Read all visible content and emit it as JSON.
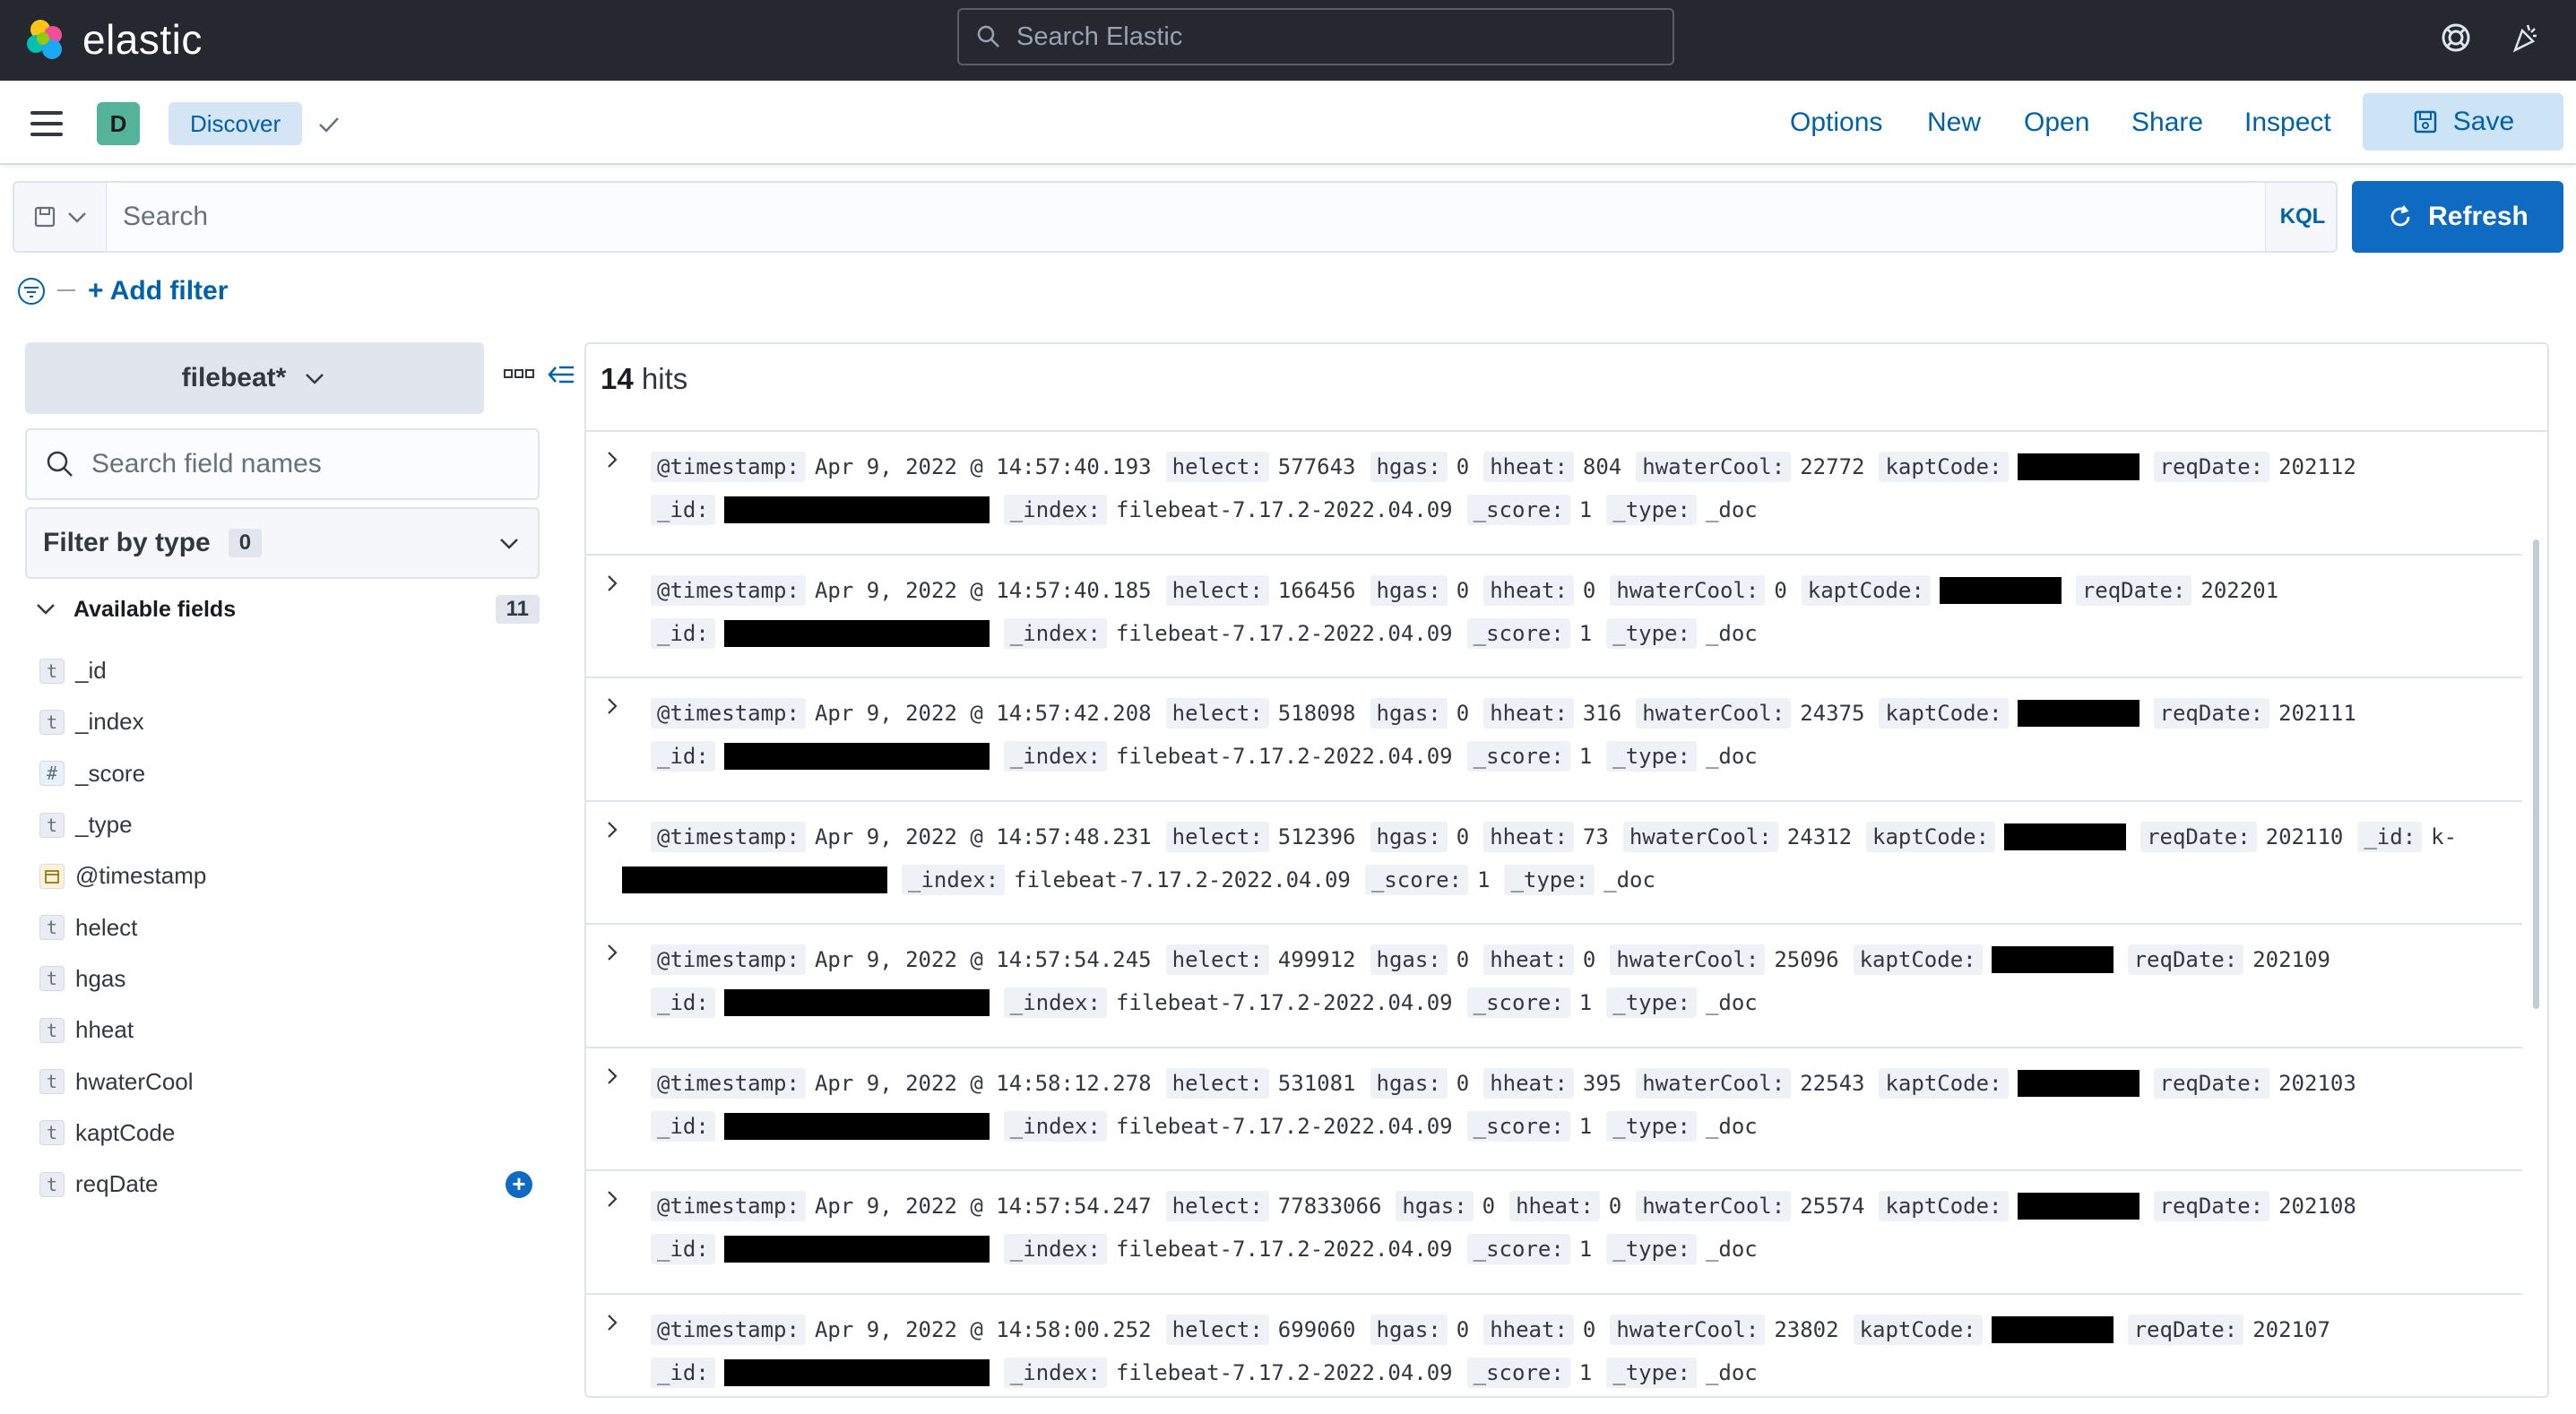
{
  "header": {
    "brand": "elastic",
    "search_placeholder": "Search Elastic"
  },
  "app_bar": {
    "avatar_letter": "D",
    "breadcrumb": "Discover",
    "menu": [
      "Options",
      "New",
      "Open",
      "Share",
      "Inspect"
    ],
    "save_label": "Save"
  },
  "query": {
    "placeholder": "Search",
    "language": "KQL",
    "refresh_label": "Refresh",
    "add_filter_label": "+ Add filter"
  },
  "sidebar": {
    "index_pattern": "filebeat*",
    "field_search_placeholder": "Search field names",
    "filter_by_type_label": "Filter by type",
    "filter_by_type_count": "0",
    "available_fields_label": "Available fields",
    "available_fields_count": "11",
    "fields": [
      {
        "type": "t",
        "name": "_id"
      },
      {
        "type": "t",
        "name": "_index"
      },
      {
        "type": "#",
        "name": "_score"
      },
      {
        "type": "t",
        "name": "_type"
      },
      {
        "type": "date",
        "name": "@timestamp"
      },
      {
        "type": "t",
        "name": "helect"
      },
      {
        "type": "t",
        "name": "hgas"
      },
      {
        "type": "t",
        "name": "hheat"
      },
      {
        "type": "t",
        "name": "hwaterCool"
      },
      {
        "type": "t",
        "name": "kaptCode"
      },
      {
        "type": "t",
        "name": "reqDate"
      }
    ]
  },
  "results": {
    "hits_count": "14",
    "hits_label": "hits",
    "rows": [
      {
        "timestamp": "Apr 9, 2022 @ 14:57:40.193",
        "helect": "577643",
        "hgas": "0",
        "hheat": "804",
        "hwaterCool": "22772",
        "reqDate": "202112",
        "index": "filebeat-7.17.2-2022.04.09",
        "score": "1",
        "type": "_doc"
      },
      {
        "timestamp": "Apr 9, 2022 @ 14:57:40.185",
        "helect": "166456",
        "hgas": "0",
        "hheat": "0",
        "hwaterCool": "0",
        "reqDate": "202201",
        "index": "filebeat-7.17.2-2022.04.09",
        "score": "1",
        "type": "_doc"
      },
      {
        "timestamp": "Apr 9, 2022 @ 14:57:42.208",
        "helect": "518098",
        "hgas": "0",
        "hheat": "316",
        "hwaterCool": "24375",
        "reqDate": "202111",
        "index": "filebeat-7.17.2-2022.04.09",
        "score": "1",
        "type": "_doc"
      },
      {
        "timestamp": "Apr 9, 2022 @ 14:57:48.231",
        "helect": "512396",
        "hgas": "0",
        "hheat": "73",
        "hwaterCool": "24312",
        "reqDate": "202110",
        "id_prefix": "k-",
        "index": "filebeat-7.17.2-2022.04.09",
        "score": "1",
        "type": "_doc"
      },
      {
        "timestamp": "Apr 9, 2022 @ 14:57:54.245",
        "helect": "499912",
        "hgas": "0",
        "hheat": "0",
        "hwaterCool": "25096",
        "reqDate": "202109",
        "index": "filebeat-7.17.2-2022.04.09",
        "score": "1",
        "type": "_doc"
      },
      {
        "timestamp": "Apr 9, 2022 @ 14:58:12.278",
        "helect": "531081",
        "hgas": "0",
        "hheat": "395",
        "hwaterCool": "22543",
        "reqDate": "202103",
        "index": "filebeat-7.17.2-2022.04.09",
        "score": "1",
        "type": "_doc"
      },
      {
        "timestamp": "Apr 9, 2022 @ 14:57:54.247",
        "helect": "77833066",
        "hgas": "0",
        "hheat": "0",
        "hwaterCool": "25574",
        "reqDate": "202108",
        "index": "filebeat-7.17.2-2022.04.09",
        "score": "1",
        "type": "_doc"
      },
      {
        "timestamp": "Apr 9, 2022 @ 14:58:00.252",
        "helect": "699060",
        "hgas": "0",
        "hheat": "0",
        "hwaterCool": "23802",
        "reqDate": "202107",
        "index": "filebeat-7.17.2-2022.04.09",
        "score": "1",
        "type": "_doc"
      }
    ]
  },
  "colors": {
    "header_bg": "#25282f",
    "link": "#0061a6",
    "primary": "#0f6ac2",
    "avatar": "#54b399"
  },
  "icons": [
    "elastic-logo",
    "search-icon",
    "help-icon",
    "newsfeed-icon",
    "menu-icon",
    "check-icon",
    "save-icon",
    "saved-query-icon",
    "chevron-down-icon",
    "refresh-icon",
    "filter-icon",
    "options-icon",
    "collapse-icon",
    "field-type-icon",
    "add-icon",
    "expand-icon"
  ]
}
